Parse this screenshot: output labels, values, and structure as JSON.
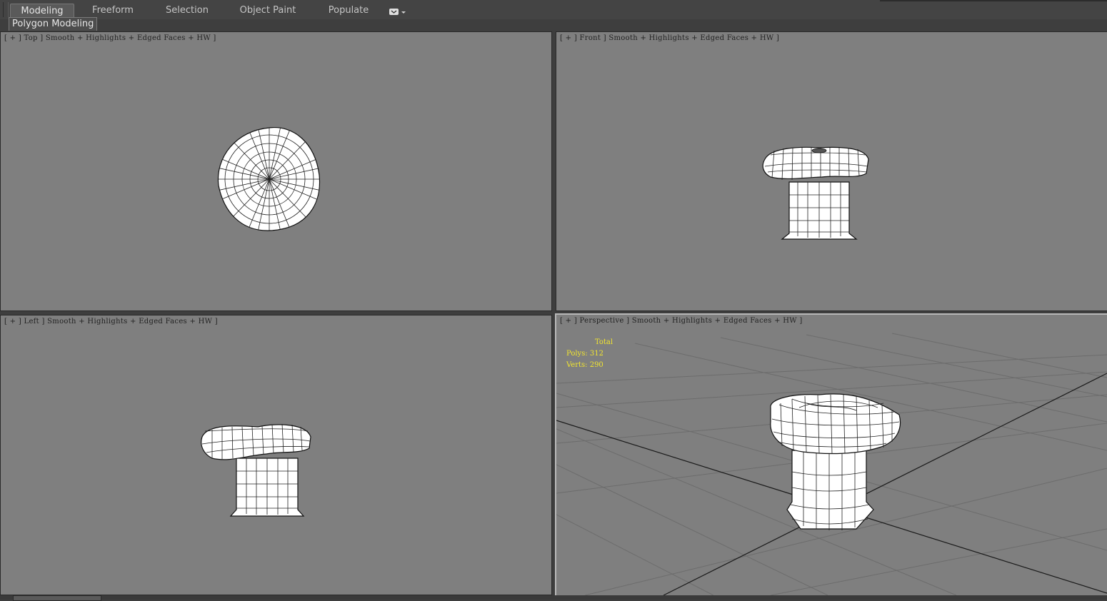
{
  "ribbon": {
    "tabs": [
      {
        "label": "Modeling",
        "active": true
      },
      {
        "label": "Freeform",
        "active": false
      },
      {
        "label": "Selection",
        "active": false
      },
      {
        "label": "Object Paint",
        "active": false
      },
      {
        "label": "Populate",
        "active": false
      }
    ],
    "more_icon": "ribbon-options-icon",
    "panel_label": "Polygon Modeling"
  },
  "viewports": {
    "top": {
      "label": "[ + ] Top ] Smooth + Highlights + Edged Faces + HW ]"
    },
    "front": {
      "label": "[ + ] Front ] Smooth + Highlights + Edged Faces + HW ]"
    },
    "left": {
      "label": "[ + ] Left ] Smooth + Highlights + Edged Faces + HW ]"
    },
    "perspective": {
      "label": "[ + ] Perspective ] Smooth + Highlights + Edged Faces + HW ]",
      "active": true,
      "stats": {
        "title": "Total",
        "polys": "Polys: 312",
        "verts": "Verts: 290"
      }
    }
  },
  "colors": {
    "viewport_bg": "#7f7f7f",
    "stats_text": "#f2e52f",
    "ui_bg": "#444444"
  }
}
